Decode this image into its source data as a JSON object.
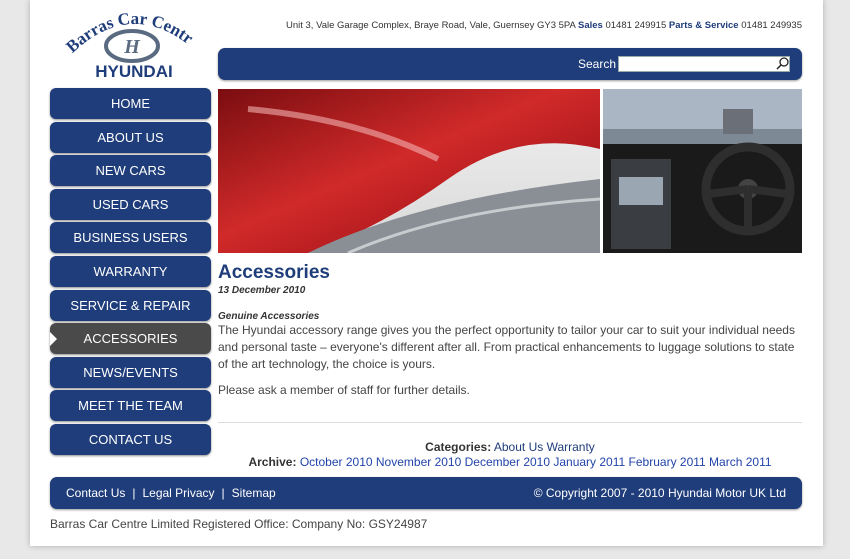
{
  "brand": {
    "logo_top": "Barras Car Centre",
    "logo_bottom": "HYUNDAI"
  },
  "header": {
    "address": "Unit 3, Vale Garage Complex, Braye Road, Vale, Guernsey GY3 5PA",
    "sales_label": "Sales",
    "sales_phone": "01481 249915",
    "parts_label": "Parts & Service",
    "parts_phone": "01481 249935"
  },
  "search": {
    "label": "Search",
    "value": ""
  },
  "nav": [
    {
      "label": "HOME"
    },
    {
      "label": "ABOUT US"
    },
    {
      "label": "NEW CARS"
    },
    {
      "label": "USED CARS"
    },
    {
      "label": "BUSINESS USERS"
    },
    {
      "label": "WARRANTY"
    },
    {
      "label": "SERVICE & REPAIR"
    },
    {
      "label": "ACCESSORIES",
      "active": true
    },
    {
      "label": "NEWS/EVENTS"
    },
    {
      "label": "MEET THE TEAM"
    },
    {
      "label": "CONTACT US"
    }
  ],
  "article": {
    "title": "Accessories",
    "date": "13 December 2010",
    "subheading": "Genuine Accessories",
    "body": "The Hyundai accessory range gives you the perfect opportunity to tailor your car to suit your individual needs and personal taste – everyone's different after all. From practical enhancements to luggage solutions to state of the art technology, the choice is yours.",
    "body2": "Please ask a member of staff for further details."
  },
  "categories": {
    "label": "Categories:",
    "items": [
      "About Us",
      "Warranty"
    ]
  },
  "archive": {
    "label": "Archive:",
    "items": [
      "October 2010",
      "November 2010",
      "December 2010",
      "January 2011",
      "February 2011",
      "March 2011"
    ]
  },
  "footer": {
    "links": [
      "Contact Us",
      "Legal Privacy",
      "Sitemap"
    ],
    "copyright": "© Copyright 2007 - 2010 Hyundai Motor UK Ltd"
  },
  "registered": "Barras Car Centre Limited Registered Office: Company No: GSY24987",
  "colors": {
    "brand_blue": "#1f3d7a",
    "active_grey": "#4a4a4a"
  }
}
